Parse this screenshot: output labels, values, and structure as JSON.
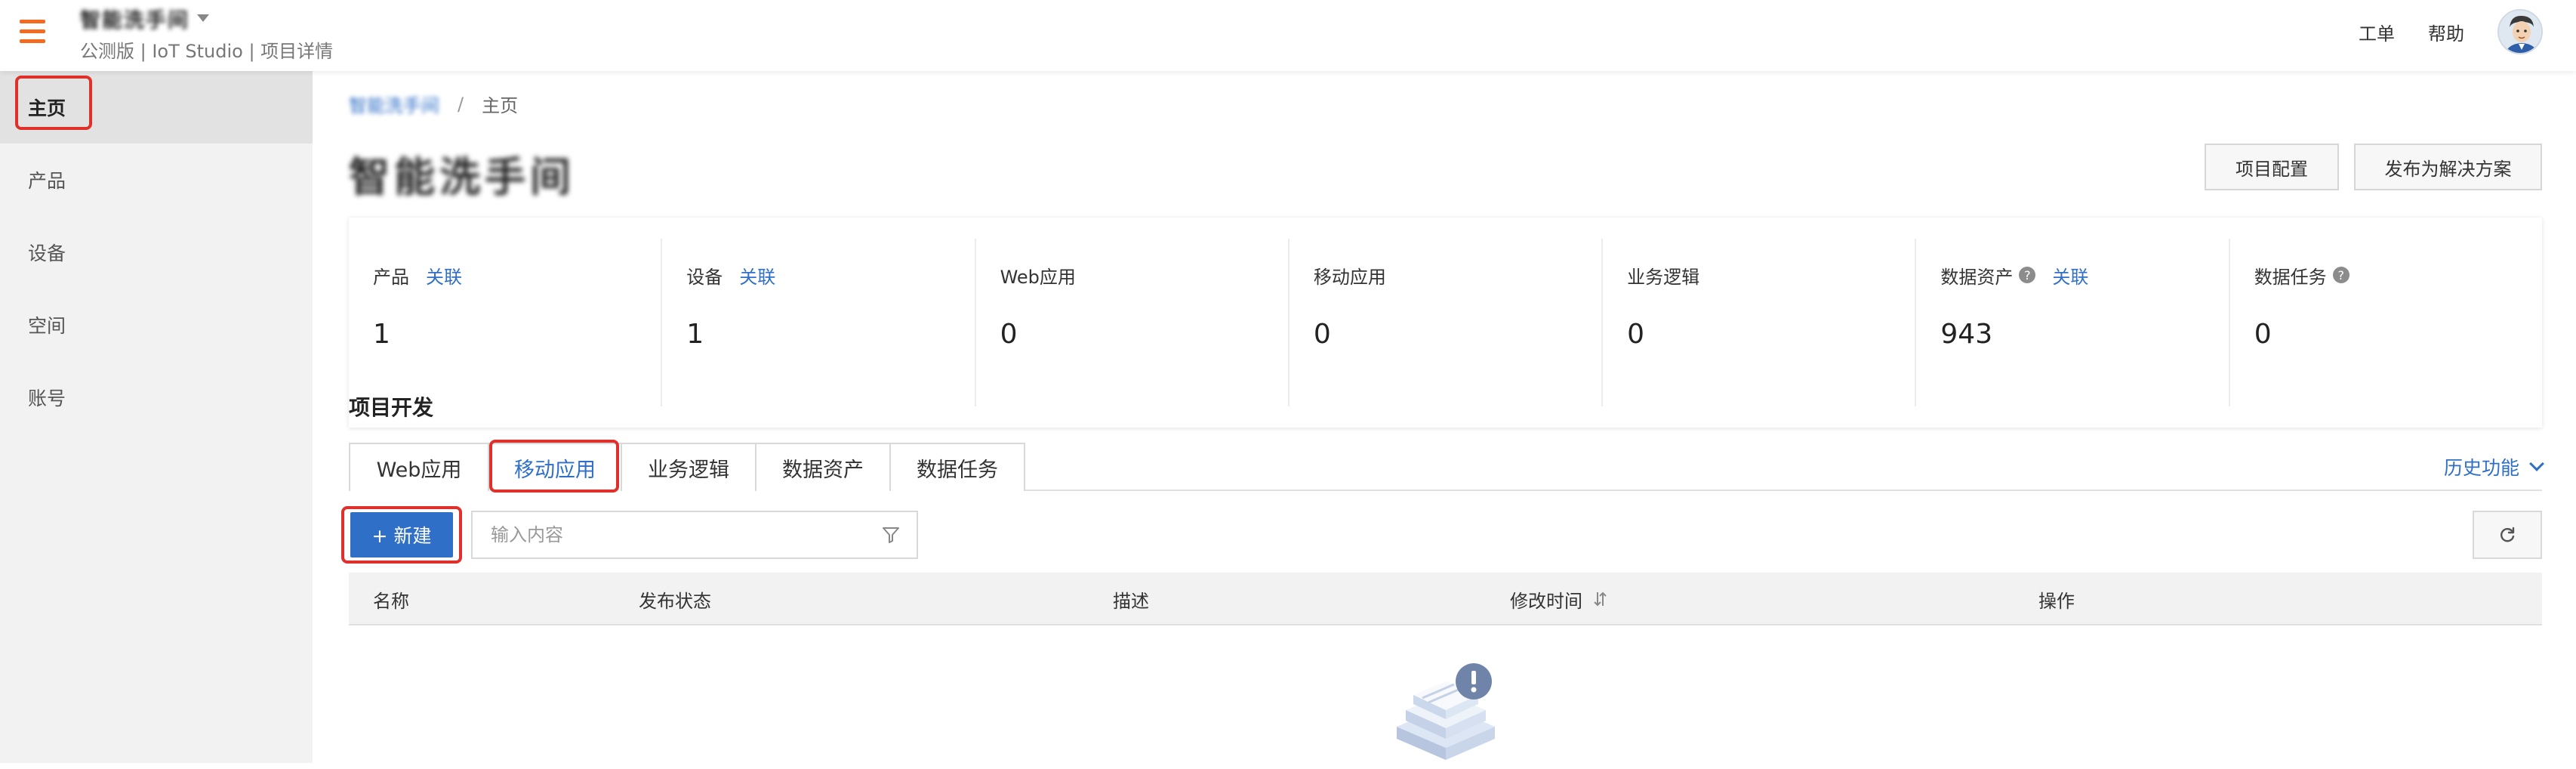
{
  "header": {
    "project_name": "智能洗手间",
    "subtitle": "公测版 | IoT Studio | 项目详情",
    "links": [
      "工单",
      "帮助"
    ]
  },
  "sidebar": {
    "items": [
      {
        "label": "主页",
        "active": true
      },
      {
        "label": "产品",
        "active": false
      },
      {
        "label": "设备",
        "active": false
      },
      {
        "label": "空间",
        "active": false
      },
      {
        "label": "账号",
        "active": false
      }
    ]
  },
  "breadcrumb": {
    "parent": "智能洗手间",
    "separator": "/",
    "current": "主页"
  },
  "page": {
    "title": "智能洗手间",
    "buttons": [
      "项目配置",
      "发布为解决方案"
    ]
  },
  "stats": [
    {
      "label": "产品",
      "link": "关联",
      "value": "1",
      "help": false
    },
    {
      "label": "设备",
      "link": "关联",
      "value": "1",
      "help": false
    },
    {
      "label": "Web应用",
      "link": "",
      "value": "0",
      "help": false
    },
    {
      "label": "移动应用",
      "link": "",
      "value": "0",
      "help": false
    },
    {
      "label": "业务逻辑",
      "link": "",
      "value": "0",
      "help": false
    },
    {
      "label": "数据资产",
      "link": "关联",
      "value": "943",
      "help": true
    },
    {
      "label": "数据任务",
      "link": "",
      "value": "0",
      "help": true
    }
  ],
  "dev": {
    "section_title": "项目开发",
    "tabs": [
      {
        "label": "Web应用",
        "active": false
      },
      {
        "label": "移动应用",
        "active": true
      },
      {
        "label": "业务逻辑",
        "active": false
      },
      {
        "label": "数据资产",
        "active": false
      },
      {
        "label": "数据任务",
        "active": false
      }
    ],
    "history_label": "历史功能",
    "new_button": "+ 新建",
    "search_placeholder": "输入内容",
    "search_value": "",
    "columns": [
      "名称",
      "发布状态",
      "描述",
      "修改时间",
      "操作"
    ]
  },
  "colors": {
    "accent": "#2f6fc8",
    "menu_icon": "#f26b21",
    "highlight": "#e0302b",
    "sidebar_bg": "#f2f2f2"
  },
  "icons": [
    "menu-icon",
    "caret-down-icon",
    "avatar-icon",
    "help-icon",
    "chevron-down-icon",
    "filter-icon",
    "refresh-icon",
    "sort-icon",
    "empty-state-icon"
  ]
}
